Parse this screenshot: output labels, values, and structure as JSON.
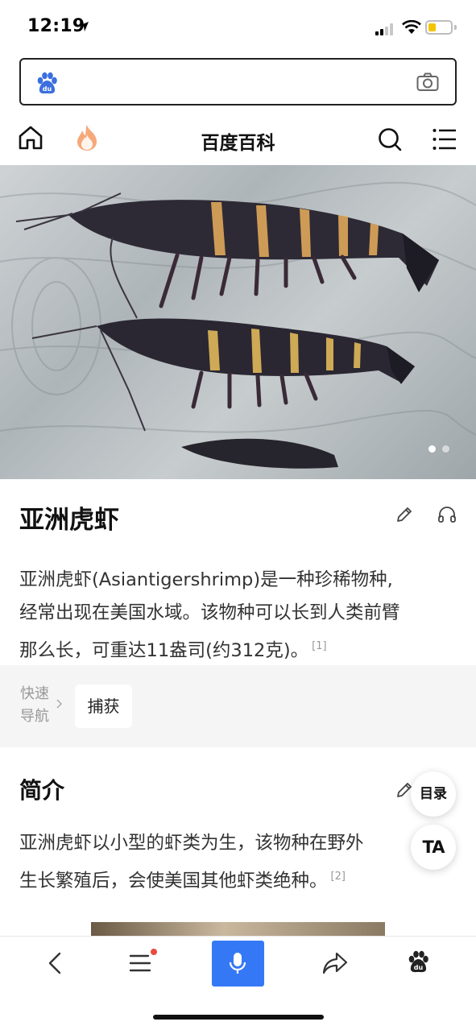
{
  "status_bar": {
    "time": "12:19"
  },
  "search": {
    "placeholder": ""
  },
  "nav": {
    "title": "百度百科"
  },
  "hero": {
    "total_slides": 2,
    "active_slide": 1
  },
  "article": {
    "title": "亚洲虎虾",
    "summary_lines": [
      "亚洲虎虾(Asiantigershrimp)是一种珍稀物种,",
      "经常出现在美国水域。该物种可以长到人类前臂",
      "那么长，可重达11盎司(约312克)。"
    ],
    "summary_ref": "[1]"
  },
  "quick_nav": {
    "label_line1": "快速",
    "label_line2": "导航",
    "item": "捕获"
  },
  "intro": {
    "heading": "简介",
    "lines": [
      "亚洲虎虾以小型的虾类为生，该物种在野外",
      "生长繁殖后，会使美国其他虾类绝种。"
    ],
    "ref": "[2]"
  },
  "floating": {
    "toc": "目录",
    "text_size": "TA"
  },
  "colors": {
    "accent": "#3478f6",
    "badge": "#e84c3d",
    "battery": "#f5c400"
  },
  "icons": [
    "location-arrow-icon",
    "signal-icon",
    "wifi-icon",
    "battery-icon",
    "baidu-paw-icon",
    "camera-icon",
    "home-icon",
    "fire-icon",
    "search-icon",
    "menu-icon",
    "pencil-icon",
    "headphones-icon",
    "chevron-right-icon",
    "back-icon",
    "list-icon",
    "microphone-icon",
    "share-icon"
  ]
}
